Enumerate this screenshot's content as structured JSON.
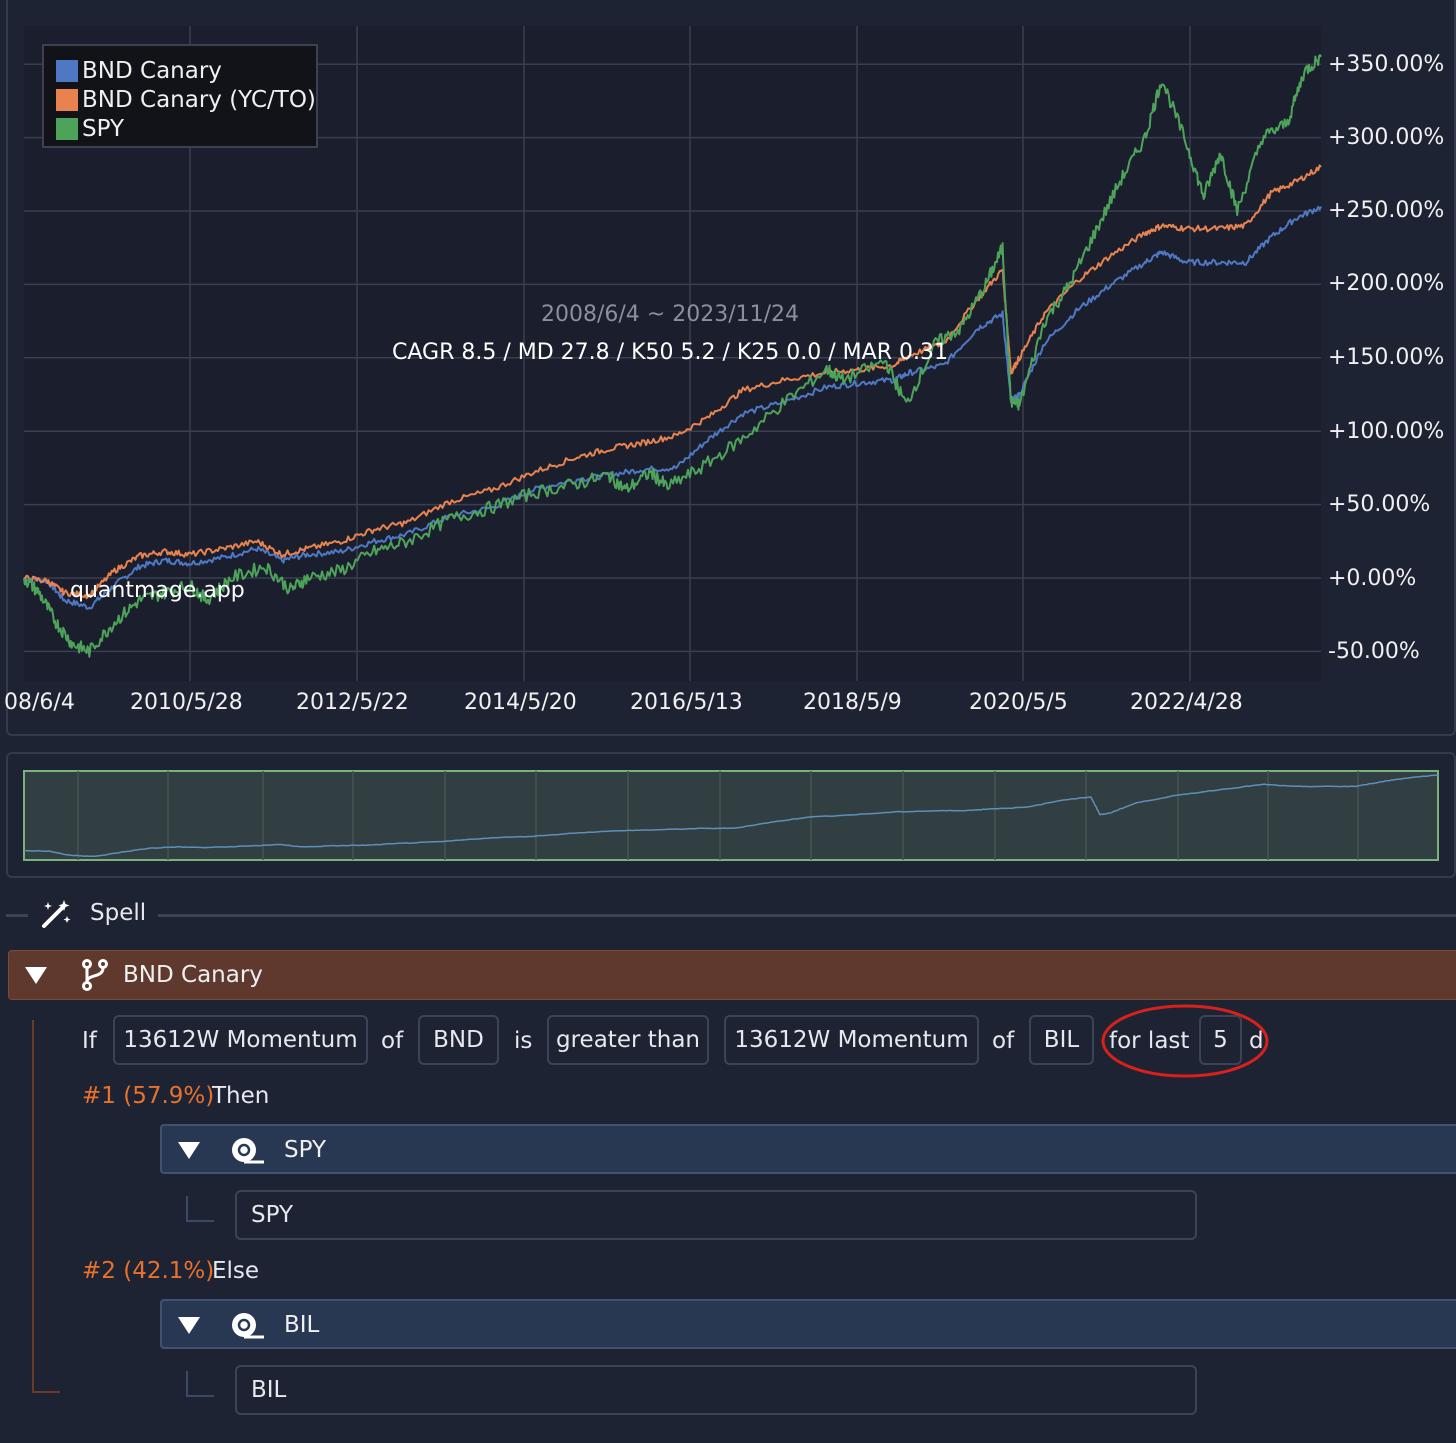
{
  "chart": {
    "legend": [
      {
        "label": "BND Canary",
        "color": "#4f78c4"
      },
      {
        "label": "BND Canary (YC/TO)",
        "color": "#e8834f"
      },
      {
        "label": "SPY",
        "color": "#4ea35b"
      }
    ],
    "range_text": "2008/6/4 ~ 2023/11/24",
    "stats_text": "CAGR 8.5 / MD 27.8 / K50 5.2 / K25 0.0 / MAR 0.31",
    "watermark": "quantmage.app"
  },
  "chart_data": {
    "type": "line",
    "x_tick_labels": [
      "08/6/4",
      "2010/5/28",
      "2012/5/22",
      "2014/5/20",
      "2016/5/13",
      "2018/5/9",
      "2020/5/5",
      "2022/4/28"
    ],
    "y_tick_labels": [
      "+350.00%",
      "+300.00%",
      "+250.00%",
      "+200.00%",
      "+150.00%",
      "+100.00%",
      "+50.00%",
      "+0.00%",
      "-50.00%"
    ],
    "y_ticks": [
      350,
      300,
      250,
      200,
      150,
      100,
      50,
      0,
      -50
    ],
    "ylim": [
      -55,
      370
    ],
    "xlim": [
      2008.42,
      2023.9
    ],
    "grid": true,
    "legend_position": "top-left",
    "series": [
      {
        "name": "BND Canary",
        "color": "#4f78c4",
        "x": [
          2008.42,
          2008.7,
          2008.9,
          2009.2,
          2009.5,
          2009.8,
          2010.1,
          2010.4,
          2010.8,
          2011.2,
          2011.5,
          2011.8,
          2012.2,
          2012.6,
          2013.0,
          2013.5,
          2014.0,
          2014.5,
          2015.0,
          2015.4,
          2015.8,
          2016.2,
          2016.6,
          2017.0,
          2017.5,
          2018.0,
          2018.4,
          2018.8,
          2019.0,
          2019.4,
          2019.8,
          2020.1,
          2020.2,
          2020.3,
          2020.6,
          2021.0,
          2021.4,
          2021.8,
          2022.0,
          2022.3,
          2022.7,
          2023.0,
          2023.3,
          2023.6,
          2023.9
        ],
        "y": [
          0,
          -2,
          -15,
          -20,
          -5,
          8,
          12,
          10,
          14,
          20,
          12,
          16,
          18,
          25,
          30,
          42,
          48,
          60,
          67,
          70,
          74,
          75,
          95,
          112,
          120,
          130,
          133,
          135,
          140,
          145,
          170,
          180,
          120,
          125,
          160,
          183,
          200,
          215,
          222,
          215,
          215,
          215,
          232,
          245,
          253
        ]
      },
      {
        "name": "BND Canary (YC/TO)",
        "color": "#e8834f",
        "x": [
          2008.42,
          2008.7,
          2008.9,
          2009.2,
          2009.5,
          2009.8,
          2010.1,
          2010.4,
          2010.8,
          2011.2,
          2011.5,
          2011.8,
          2012.2,
          2012.6,
          2013.0,
          2013.5,
          2014.0,
          2014.5,
          2015.0,
          2015.4,
          2015.8,
          2016.2,
          2016.6,
          2017.0,
          2017.5,
          2018.0,
          2018.4,
          2018.8,
          2019.0,
          2019.4,
          2019.8,
          2020.1,
          2020.2,
          2020.3,
          2020.6,
          2021.0,
          2021.4,
          2021.8,
          2022.0,
          2022.3,
          2022.7,
          2023.0,
          2023.3,
          2023.6,
          2023.9
        ],
        "y": [
          0,
          -2,
          -10,
          -12,
          5,
          15,
          18,
          16,
          20,
          25,
          16,
          20,
          25,
          33,
          38,
          52,
          60,
          72,
          82,
          88,
          92,
          97,
          110,
          128,
          135,
          140,
          142,
          145,
          152,
          160,
          190,
          210,
          140,
          150,
          180,
          203,
          220,
          235,
          240,
          238,
          238,
          240,
          262,
          270,
          280
        ]
      },
      {
        "name": "SPY",
        "color": "#4ea35b",
        "x": [
          2008.42,
          2008.6,
          2008.8,
          2009.0,
          2009.2,
          2009.5,
          2009.8,
          2010.1,
          2010.4,
          2010.6,
          2010.9,
          2011.3,
          2011.6,
          2011.8,
          2012.2,
          2012.6,
          2013.0,
          2013.5,
          2014.0,
          2014.5,
          2015.0,
          2015.4,
          2015.6,
          2015.9,
          2016.1,
          2016.5,
          2017.0,
          2017.5,
          2018.0,
          2018.2,
          2018.7,
          2018.95,
          2019.3,
          2019.6,
          2019.9,
          2020.1,
          2020.2,
          2020.3,
          2020.6,
          2020.9,
          2021.2,
          2021.5,
          2021.8,
          2022.0,
          2022.3,
          2022.5,
          2022.7,
          2022.9,
          2023.2,
          2023.5,
          2023.7,
          2023.9
        ],
        "y": [
          0,
          -10,
          -30,
          -45,
          -50,
          -30,
          -15,
          -10,
          -5,
          -15,
          0,
          8,
          -8,
          0,
          5,
          18,
          25,
          40,
          48,
          58,
          64,
          70,
          60,
          72,
          62,
          75,
          95,
          120,
          142,
          135,
          148,
          118,
          160,
          170,
          200,
          225,
          120,
          118,
          175,
          200,
          235,
          270,
          300,
          340,
          295,
          260,
          290,
          250,
          300,
          310,
          345,
          355
        ]
      }
    ]
  },
  "spell": {
    "title": "Spell",
    "node": {
      "title": "BND Canary",
      "condition": {
        "if_label": "If",
        "left_indicator": "13612W Momentum",
        "of_label_1": "of",
        "left_asset": "BND",
        "is_label": "is",
        "comparator": "greater than",
        "right_indicator": "13612W Momentum",
        "of_label_2": "of",
        "right_asset": "BIL",
        "for_last_label": "for last",
        "days_value": "5",
        "days_unit": "d"
      },
      "branches": [
        {
          "weight": "#1 (57.9%)",
          "label": "Then",
          "asset_title": "SPY",
          "asset_value": "SPY"
        },
        {
          "weight": "#2 (42.1%)",
          "label": "Else",
          "asset_title": "BIL",
          "asset_value": "BIL"
        }
      ]
    }
  },
  "colors": {
    "background": "#1e2333",
    "plot_background": "#1b1f2d",
    "node_bar": "#5f392e",
    "asset_bar": "#283852",
    "weight_text": "#e8722c",
    "highlight": "#d8211b"
  }
}
